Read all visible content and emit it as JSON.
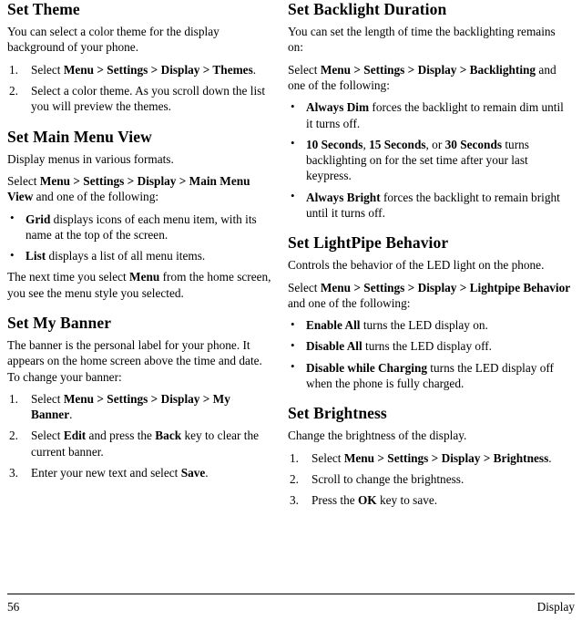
{
  "page": {
    "number": "56",
    "chapter": "Display"
  },
  "left_column": {
    "sections": [
      {
        "heading": "Set Theme",
        "intro": "You can select a color theme for the display background of your phone.",
        "steps": [
          {
            "num": "1.",
            "parts": [
              {
                "t": "Select ",
                "b": false
              },
              {
                "t": "Menu > Settings > Display > Themes",
                "b": true
              },
              {
                "t": ".",
                "b": false
              }
            ]
          },
          {
            "num": "2.",
            "parts": [
              {
                "t": "Select a color theme. As you scroll down the list you will preview the themes.",
                "b": false
              }
            ]
          }
        ]
      },
      {
        "heading": "Set Main Menu View",
        "intro": "Display menus in various formats.",
        "select_line": [
          {
            "t": "Select ",
            "b": false
          },
          {
            "t": "Menu > Settings > Display > Main Menu View",
            "b": true
          },
          {
            "t": " and one of the following:",
            "b": false
          }
        ],
        "bullets": [
          [
            {
              "t": "Grid",
              "b": true
            },
            {
              "t": " displays icons of each menu item, with its name at the top of the screen.",
              "b": false
            }
          ],
          [
            {
              "t": "List",
              "b": true
            },
            {
              "t": " displays a list of all menu items.",
              "b": false
            }
          ]
        ],
        "outro": [
          {
            "t": "The next time you select ",
            "b": false
          },
          {
            "t": "Menu",
            "b": true
          },
          {
            "t": " from the home screen, you see the menu style you selected.",
            "b": false
          }
        ]
      },
      {
        "heading": "Set My Banner",
        "intro": "The banner is the personal label for your phone. It appears on the home screen above the time and date. To change your banner:",
        "steps": [
          {
            "num": "1.",
            "parts": [
              {
                "t": "Select ",
                "b": false
              },
              {
                "t": "Menu > Settings > Display > My Banner",
                "b": true
              },
              {
                "t": ".",
                "b": false
              }
            ]
          },
          {
            "num": "2.",
            "parts": [
              {
                "t": "Select ",
                "b": false
              },
              {
                "t": "Edit",
                "b": true
              },
              {
                "t": " and press the ",
                "b": false
              },
              {
                "t": "Back",
                "b": true
              },
              {
                "t": " key to clear the current banner.",
                "b": false
              }
            ]
          },
          {
            "num": "3.",
            "parts": [
              {
                "t": "Enter your new text and select ",
                "b": false
              },
              {
                "t": "Save",
                "b": true
              },
              {
                "t": ".",
                "b": false
              }
            ]
          }
        ]
      }
    ]
  },
  "right_column": {
    "sections": [
      {
        "heading": "Set Backlight Duration",
        "intro": "You can set the length of time the backlighting remains on:",
        "select_line": [
          {
            "t": "Select ",
            "b": false
          },
          {
            "t": "Menu > Settings > Display > Backlighting",
            "b": true
          },
          {
            "t": " and one of the following:",
            "b": false
          }
        ],
        "bullets": [
          [
            {
              "t": "Always Dim",
              "b": true
            },
            {
              "t": " forces the backlight to remain dim until it turns off.",
              "b": false
            }
          ],
          [
            {
              "t": "10 Seconds",
              "b": true
            },
            {
              "t": ", ",
              "b": false
            },
            {
              "t": "15 Seconds",
              "b": true
            },
            {
              "t": ", or ",
              "b": false
            },
            {
              "t": "30 Seconds",
              "b": true
            },
            {
              "t": " turns backlighting on for the set time after your last keypress.",
              "b": false
            }
          ],
          [
            {
              "t": "Always Bright",
              "b": true
            },
            {
              "t": " forces the backlight to remain bright until it turns off.",
              "b": false
            }
          ]
        ]
      },
      {
        "heading": "Set LightPipe Behavior",
        "intro": "Controls the behavior of the LED light on the phone.",
        "select_line": [
          {
            "t": "Select ",
            "b": false
          },
          {
            "t": "Menu > Settings > Display > Lightpipe Behavior",
            "b": true
          },
          {
            "t": " and one of the following:",
            "b": false
          }
        ],
        "bullets": [
          [
            {
              "t": "Enable All",
              "b": true
            },
            {
              "t": " turns the LED display on.",
              "b": false
            }
          ],
          [
            {
              "t": "Disable All",
              "b": true
            },
            {
              "t": " turns the LED display off.",
              "b": false
            }
          ],
          [
            {
              "t": "Disable while Charging",
              "b": true
            },
            {
              "t": " turns the LED display off when the phone is fully charged.",
              "b": false
            }
          ]
        ]
      },
      {
        "heading": "Set Brightness",
        "intro": "Change the brightness of the display.",
        "steps": [
          {
            "num": "1.",
            "parts": [
              {
                "t": "Select ",
                "b": false
              },
              {
                "t": "Menu > Settings > Display > Brightness",
                "b": true
              },
              {
                "t": ".",
                "b": false
              }
            ]
          },
          {
            "num": "2.",
            "parts": [
              {
                "t": "Scroll to change the brightness.",
                "b": false
              }
            ]
          },
          {
            "num": "3.",
            "parts": [
              {
                "t": "Press the ",
                "b": false
              },
              {
                "t": "OK",
                "b": true
              },
              {
                "t": " key to save.",
                "b": false
              }
            ]
          }
        ]
      }
    ]
  }
}
